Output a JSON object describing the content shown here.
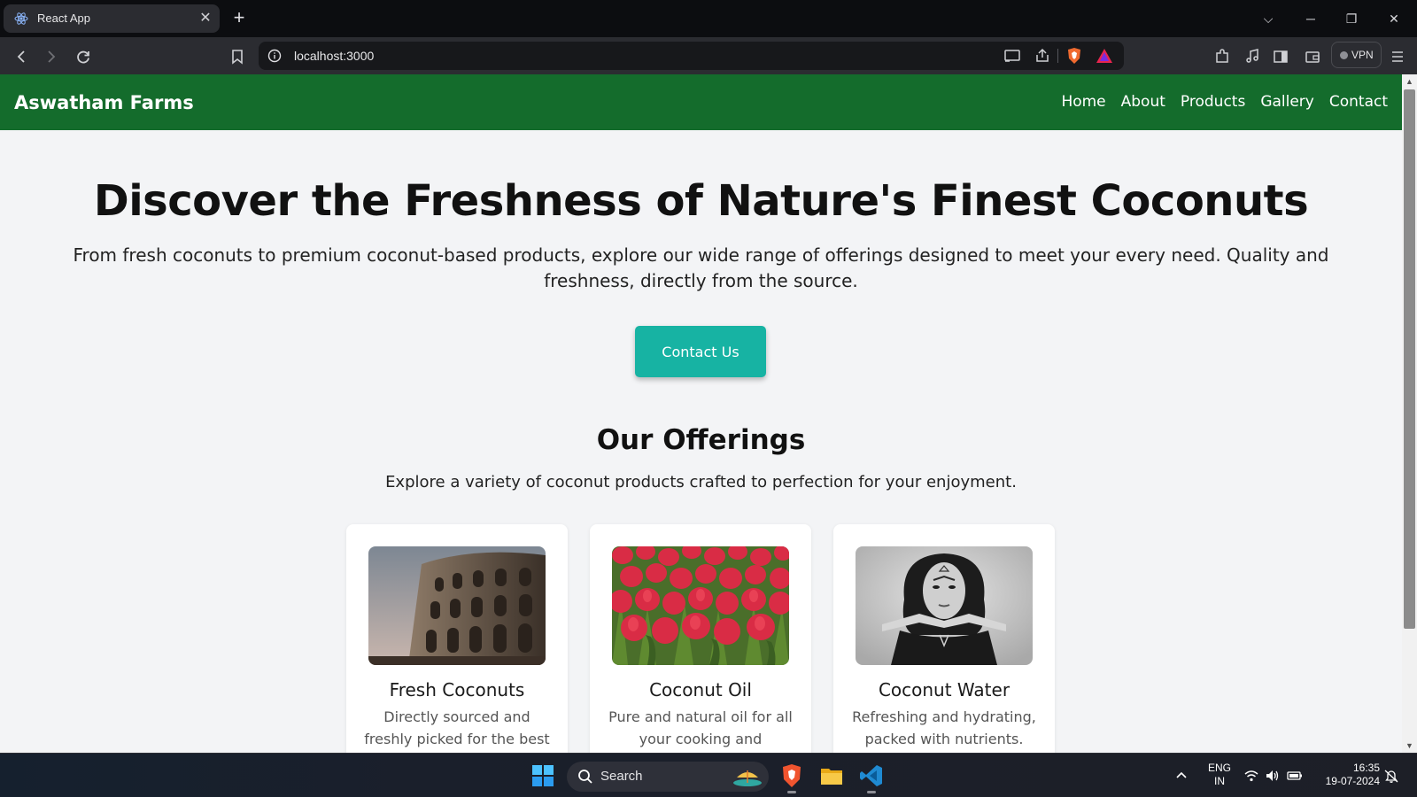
{
  "browser": {
    "tab_title": "React App",
    "url": "localhost:3000",
    "vpn_label": "VPN"
  },
  "site": {
    "brand": "Aswatham Farms",
    "nav": [
      "Home",
      "About",
      "Products",
      "Gallery",
      "Contact"
    ],
    "hero": {
      "title": "Discover the Freshness of Nature's Finest Coconuts",
      "subtitle": "From fresh coconuts to premium coconut-based products, explore our wide range of offerings designed to meet your every need. Quality and freshness, directly from the source.",
      "cta": "Contact Us"
    },
    "offerings": {
      "title": "Our Offerings",
      "subtitle": "Explore a variety of coconut products crafted to perfection for your enjoyment.",
      "cards": [
        {
          "title": "Fresh Coconuts",
          "desc": "Directly sourced and freshly picked for the best"
        },
        {
          "title": "Coconut Oil",
          "desc": "Pure and natural oil for all your cooking and skincare"
        },
        {
          "title": "Coconut Water",
          "desc": "Refreshing and hydrating, packed with nutrients."
        }
      ]
    }
  },
  "taskbar": {
    "search_label": "Search",
    "lang_line1": "ENG",
    "lang_line2": "IN",
    "time": "16:35",
    "date": "19-07-2024"
  },
  "colors": {
    "nav_green": "#146c2c",
    "cta_teal": "#17b3a3",
    "page_bg": "#f3f4f6"
  }
}
